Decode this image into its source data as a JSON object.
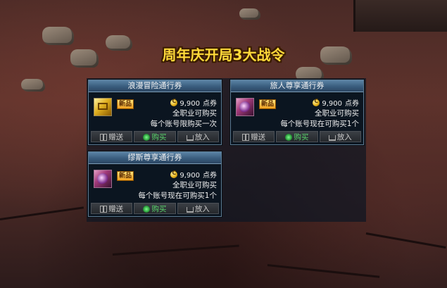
{
  "title": "周年庆开局3大战令",
  "cards": [
    {
      "name": "浪漫冒险通行券",
      "badge": "新品",
      "price": "9,900",
      "price_unit": "点券",
      "line1": "全职业可购买",
      "line2": "每个账号限购买一次",
      "icon": "golden-ticket-icon",
      "buttons": {
        "gift": "赠送",
        "buy": "购买",
        "put": "放入"
      }
    },
    {
      "name": "旅人尊享通行券",
      "badge": "新品",
      "price": "9,900",
      "price_unit": "点券",
      "line1": "全职业可购买",
      "line2": "每个账号现在可购买1个",
      "icon": "purple-ticket-icon",
      "buttons": {
        "gift": "赠送",
        "buy": "购买",
        "put": "放入"
      }
    },
    {
      "name": "缪斯尊享通行券",
      "badge": "新品",
      "price": "9,900",
      "price_unit": "点券",
      "line1": "全职业可购买",
      "line2": "每个账号现在可购买1个",
      "icon": "purple-ticket-icon",
      "buttons": {
        "gift": "赠送",
        "buy": "购买",
        "put": "放入"
      }
    }
  ]
}
